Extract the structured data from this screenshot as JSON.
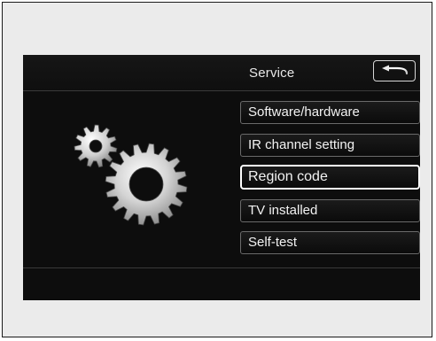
{
  "header": {
    "title": "Service",
    "back_icon": "back-arrow-icon"
  },
  "illustration": {
    "icon": "gears-icon"
  },
  "menu": {
    "items": [
      {
        "label": "Software/hardware",
        "selected": false
      },
      {
        "label": "IR channel setting",
        "selected": false
      },
      {
        "label": "Region code",
        "selected": true
      },
      {
        "label": "TV installed",
        "selected": false
      },
      {
        "label": "Self-test",
        "selected": false
      }
    ]
  },
  "colors": {
    "screen_background": "#0d0d0d",
    "text": "#f2f2f2",
    "item_border": "#6a6a6a",
    "selected_border": "#ffffff"
  }
}
